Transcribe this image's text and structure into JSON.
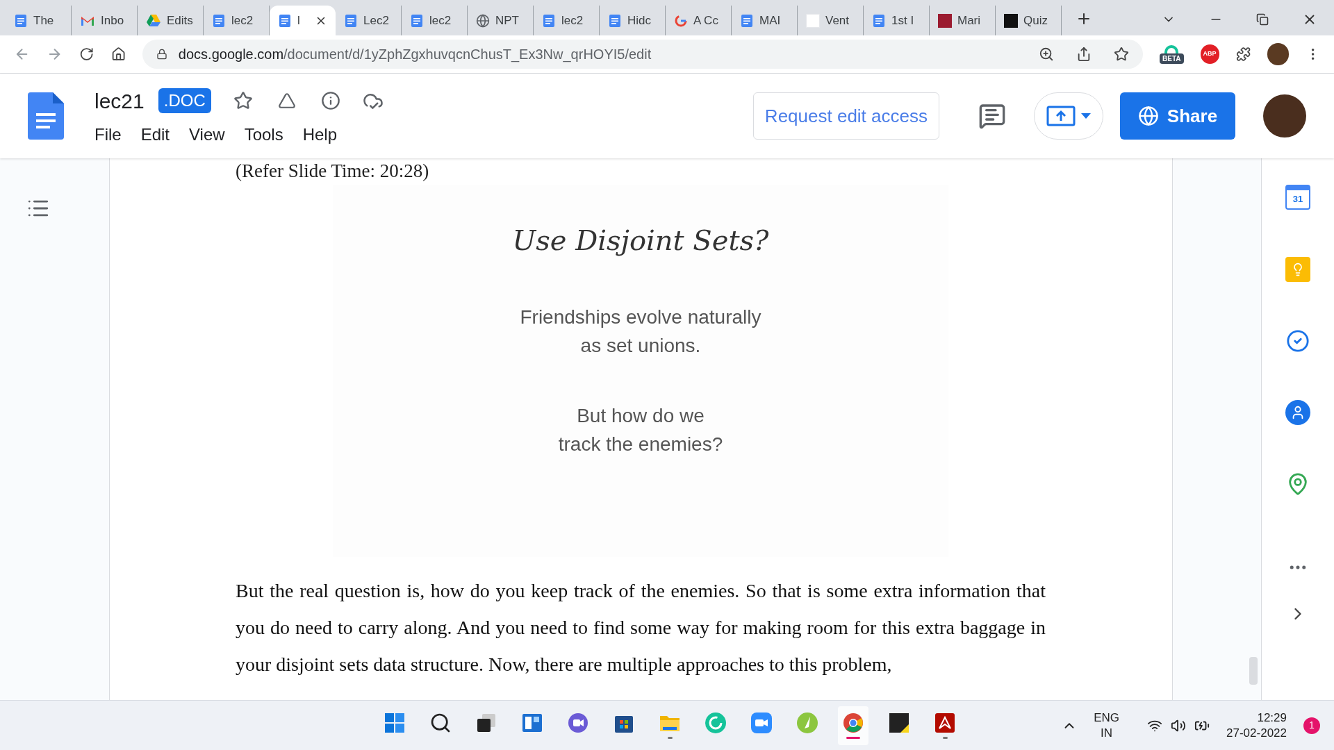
{
  "browser": {
    "tabs": [
      {
        "kind": "docs",
        "title": "The",
        "selected": false
      },
      {
        "kind": "gmail",
        "title": "Inbo",
        "selected": false
      },
      {
        "kind": "drive",
        "title": "Edits",
        "selected": false
      },
      {
        "kind": "docs",
        "title": "lec2",
        "selected": false
      },
      {
        "kind": "docs",
        "title": "l",
        "selected": true
      },
      {
        "kind": "docs",
        "title": "Lec2",
        "selected": false
      },
      {
        "kind": "docs",
        "title": "lec2",
        "selected": false
      },
      {
        "kind": "globe",
        "title": "NPT",
        "selected": false
      },
      {
        "kind": "docs",
        "title": "lec2",
        "selected": false
      },
      {
        "kind": "docs",
        "title": "Hidc",
        "selected": false
      },
      {
        "kind": "google",
        "title": "A Cc",
        "selected": false
      },
      {
        "kind": "docs",
        "title": "MAI",
        "selected": false
      },
      {
        "kind": "blank",
        "title": "Vent",
        "selected": false
      },
      {
        "kind": "docs",
        "title": "1st I",
        "selected": false
      },
      {
        "kind": "ja",
        "title": "Mari",
        "selected": false
      },
      {
        "kind": "w",
        "title": "Quiz",
        "selected": false
      }
    ],
    "url_host": "docs.google.com",
    "url_path": "/document/d/1yZphZgxhuvqcnChusT_Ex3Nw_qrHOYI5/edit",
    "extension_badge": "BETA",
    "abp": "ABP"
  },
  "docs": {
    "title": "lec21",
    "badge": ".DOC",
    "menu": [
      "File",
      "Edit",
      "View",
      "Tools",
      "Help"
    ],
    "request_button": "Request edit access",
    "share_button": "Share"
  },
  "document": {
    "caption": "(Refer Slide Time: 20:28)",
    "slide": {
      "title": "Use Disjoint Sets?",
      "lines_1": [
        "Friendships evolve naturally",
        "as set unions."
      ],
      "lines_2": [
        "But how do we",
        "track the enemies?"
      ]
    },
    "paragraph": "But the real question is, how do you keep track of the enemies. So that is some extra information that you do need to carry along. And you need to find some way for making room for this extra baggage in your disjoint sets data structure. Now, there are multiple approaches to this problem,"
  },
  "side_panel": {
    "calendar_day": "31"
  },
  "taskbar": {
    "apps": [
      {
        "running": false,
        "selected": false
      },
      {
        "running": false,
        "selected": false
      },
      {
        "running": false,
        "selected": false
      },
      {
        "running": false,
        "selected": false
      },
      {
        "running": false,
        "selected": false
      },
      {
        "running": false,
        "selected": false
      },
      {
        "running": true,
        "selected": false
      },
      {
        "running": false,
        "selected": false
      },
      {
        "running": false,
        "selected": false
      },
      {
        "running": false,
        "selected": false
      },
      {
        "running": true,
        "selected": true
      },
      {
        "running": false,
        "selected": false
      },
      {
        "running": true,
        "selected": false
      }
    ],
    "language": "ENG",
    "region": "IN",
    "time": "12:29",
    "date": "27-02-2022",
    "notifications": "1"
  }
}
